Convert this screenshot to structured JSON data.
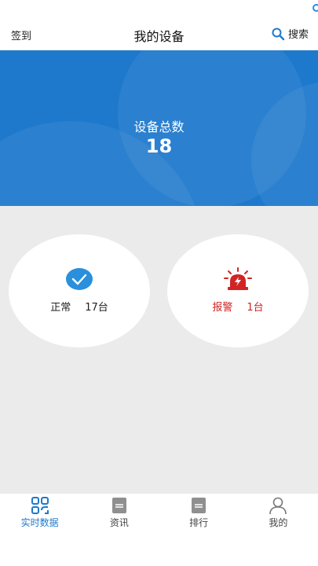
{
  "header": {
    "left_label": "签到",
    "title": "我的设备",
    "search_label": "搜索"
  },
  "summary": {
    "label": "设备总数",
    "total": "18"
  },
  "status": {
    "normal": {
      "label": "正常",
      "count": "17台"
    },
    "alarm": {
      "label": "报警",
      "count": "1台"
    }
  },
  "tabs": [
    {
      "label": "实时数据",
      "icon": "qr-grid-icon",
      "active": true
    },
    {
      "label": "资讯",
      "icon": "document-icon",
      "active": false
    },
    {
      "label": "排行",
      "icon": "document-icon",
      "active": false
    },
    {
      "label": "我的",
      "icon": "user-icon",
      "active": false
    }
  ],
  "colors": {
    "primary": "#1e79cc",
    "alarm": "#d12424",
    "background": "#ebebeb"
  }
}
